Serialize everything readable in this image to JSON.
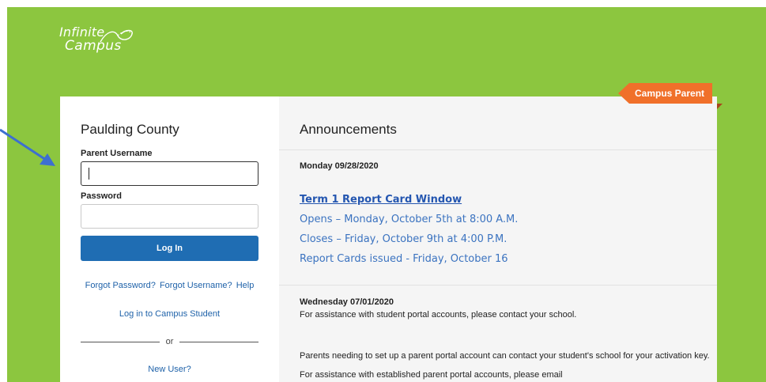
{
  "brand": {
    "logo_line1": "Infinite",
    "logo_line2": "Campus",
    "product_badge": "Campus Parent"
  },
  "login": {
    "district": "Paulding County",
    "username_label": "Parent Username",
    "username_value": "",
    "password_label": "Password",
    "password_value": "",
    "login_button": "Log In",
    "forgot_password": "Forgot Password?",
    "forgot_username": "Forgot Username?",
    "help": "Help",
    "student_link": "Log in to Campus Student",
    "or": "or",
    "new_user": "New User?"
  },
  "announcements": {
    "title": "Announcements",
    "items": [
      {
        "date": "Monday 09/28/2020",
        "headline": "Term 1 Report Card Window",
        "lines": [
          "Opens – Monday, October 5th at 8:00 A.M.",
          "Closes – Friday, October 9th at 4:00 P.M.",
          "Report Cards issued - Friday, October 16"
        ]
      },
      {
        "date": "Wednesday 07/01/2020",
        "line1": "For assistance with student portal accounts, please contact your school.",
        "paragraph": "Parents needing to set up a parent portal account can contact your student's school for your activation key.  For assistance with established parent portal accounts, please email"
      }
    ]
  },
  "colors": {
    "background": "#8cc63f",
    "primary_button": "#1f6db3",
    "link": "#1f62a9",
    "badge": "#f0702a",
    "annotation_arrow": "#3d6fd0"
  }
}
